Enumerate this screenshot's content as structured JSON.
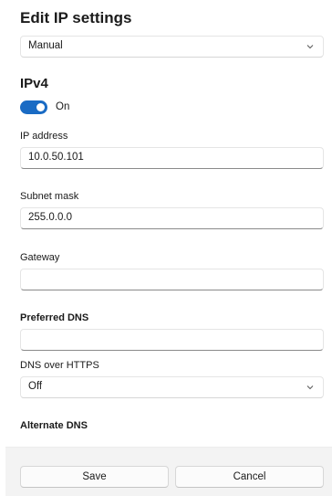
{
  "dialog": {
    "title": "Edit IP settings"
  },
  "ip_mode": {
    "selected": "Manual"
  },
  "ipv4": {
    "title": "IPv4",
    "toggle_state": "On",
    "toggle_on": true
  },
  "fields": {
    "ip_address": {
      "label": "IP address",
      "value": "10.0.50.101"
    },
    "subnet_mask": {
      "label": "Subnet mask",
      "value": "255.0.0.0"
    },
    "gateway": {
      "label": "Gateway",
      "value": ""
    },
    "preferred_dns": {
      "label": "Preferred DNS",
      "value": ""
    },
    "dns_over_https": {
      "label": "DNS over HTTPS",
      "selected": "Off"
    },
    "alternate_dns": {
      "label": "Alternate DNS"
    }
  },
  "buttons": {
    "save": "Save",
    "cancel": "Cancel"
  },
  "colors": {
    "accent": "#1a6bc4",
    "footer_bg": "#f3f3f3"
  }
}
